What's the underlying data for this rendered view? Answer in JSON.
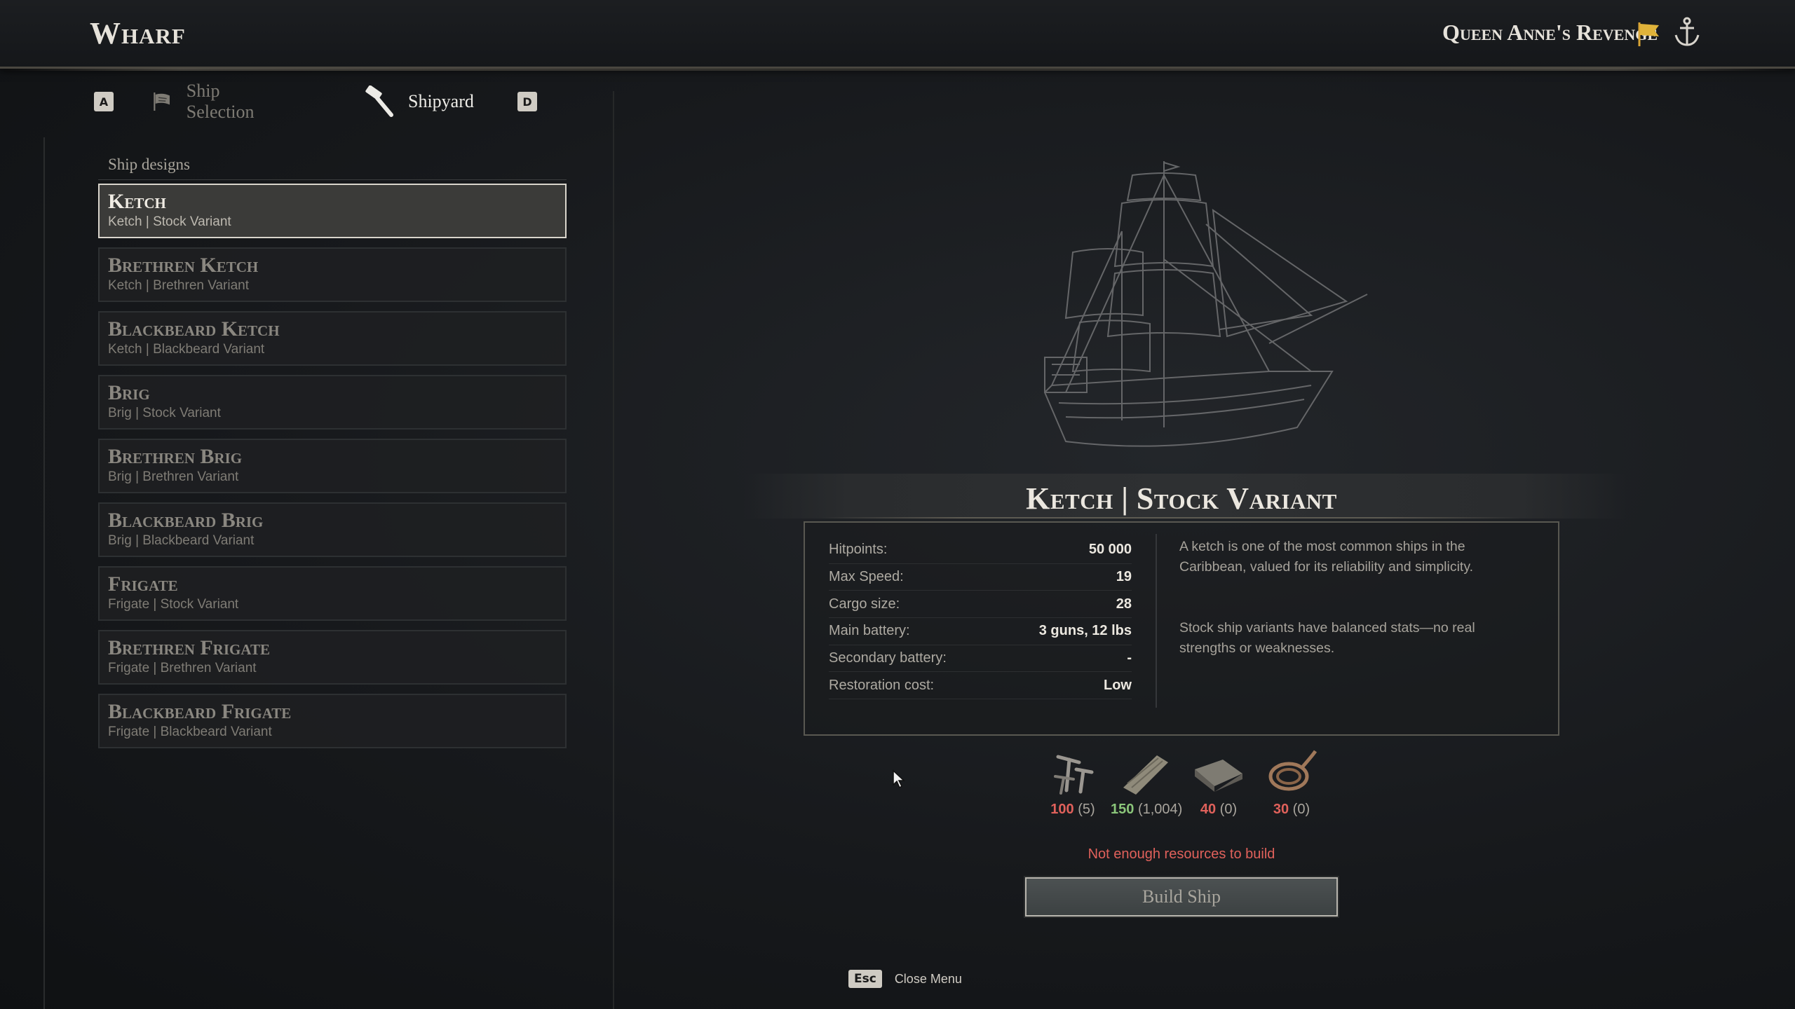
{
  "header": {
    "title": "Wharf",
    "ship_name": "Queen Anne's Revenge"
  },
  "tabs": {
    "prev_key": "A",
    "next_key": "D",
    "items": [
      {
        "label": "Ship Selection",
        "icon": "ship-flag-icon",
        "active": false
      },
      {
        "label": "Shipyard",
        "icon": "hammer-icon",
        "active": true
      }
    ]
  },
  "ship_designs": {
    "section_label": "Ship designs",
    "items": [
      {
        "name": "Ketch",
        "sub": "Ketch | Stock Variant",
        "selected": true
      },
      {
        "name": "Brethren Ketch",
        "sub": "Ketch | Brethren Variant"
      },
      {
        "name": "Blackbeard Ketch",
        "sub": "Ketch | Blackbeard Variant"
      },
      {
        "name": "Brig",
        "sub": "Brig | Stock Variant"
      },
      {
        "name": "Brethren Brig",
        "sub": "Brig | Brethren Variant"
      },
      {
        "name": "Blackbeard Brig",
        "sub": "Brig | Blackbeard Variant"
      },
      {
        "name": "Frigate",
        "sub": "Frigate | Stock Variant"
      },
      {
        "name": "Brethren Frigate",
        "sub": "Frigate | Brethren Variant"
      },
      {
        "name": "Blackbeard Frigate",
        "sub": "Frigate | Blackbeard Variant"
      }
    ]
  },
  "detail": {
    "title": "Ketch | Stock Variant",
    "stats": [
      {
        "label": "Hitpoints:",
        "value": "50 000"
      },
      {
        "label": "Max Speed:",
        "value": "19"
      },
      {
        "label": "Cargo size:",
        "value": "28"
      },
      {
        "label": "Main battery:",
        "value": "3 guns, 12 lbs"
      },
      {
        "label": "Secondary battery:",
        "value": "-"
      },
      {
        "label": "Restoration cost:",
        "value": "Low"
      }
    ],
    "description_1": "A ketch is one of the most common ships in the Caribbean, valued for its reliability and simplicity.",
    "description_2": "Stock ship variants have balanced stats—no real strengths or weaknesses."
  },
  "resources": [
    {
      "icon": "nails-icon",
      "required": "100",
      "owned": "(5)",
      "enough": false
    },
    {
      "icon": "timber-icon",
      "required": "150",
      "owned": "(1,004)",
      "enough": true
    },
    {
      "icon": "cloth-icon",
      "required": "40",
      "owned": "(0)",
      "enough": false
    },
    {
      "icon": "rope-icon",
      "required": "30",
      "owned": "(0)",
      "enough": false
    }
  ],
  "warning": "Not enough resources to build",
  "build_button": "Build Ship",
  "footer": {
    "key": "Esc",
    "label": "Close Menu"
  },
  "colors": {
    "accent_red": "#e0615b",
    "accent_green": "#8bc67a",
    "flag_yellow": "#e0b33a"
  }
}
